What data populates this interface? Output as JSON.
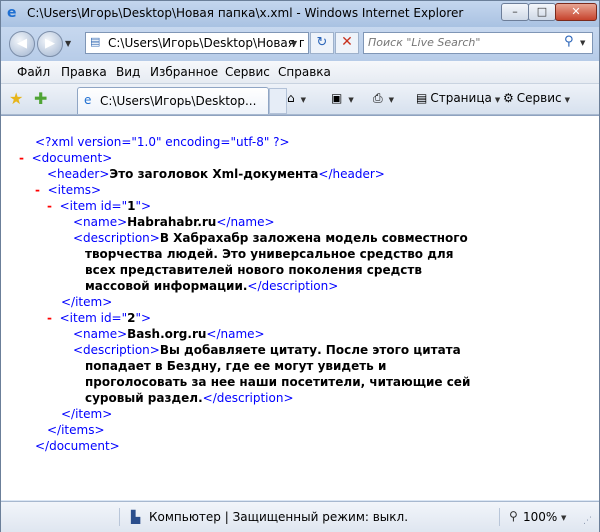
{
  "window": {
    "title": "C:\\Users\\Игорь\\Desktop\\Новая папка\\x.xml - Windows Internet Explorer",
    "minimize": "–",
    "maximize": "□",
    "close": "✕"
  },
  "address_bar": {
    "url": "C:\\Users\\Игорь\\Desktop\\Новая па",
    "search_placeholder": "Поиск \"Live Search\""
  },
  "menu": [
    "Файл",
    "Правка",
    "Вид",
    "Избранное",
    "Сервис",
    "Справка"
  ],
  "tab": {
    "title": "C:\\Users\\Игорь\\Desktop..."
  },
  "toolbar": {
    "page_label": "Страница",
    "tools_label": "Сервис"
  },
  "xml": {
    "declaration": "<?xml version=\"1.0\" encoding=\"utf-8\" ?>",
    "toggle": "-",
    "document_open": "<document>",
    "header_open": "<header>",
    "header_text": "Это заголовок Xml-документа",
    "header_close": "</header>",
    "items_open": "<items>",
    "item1_tag": "<item id=\"",
    "item1_id": "1",
    "item1_tagend": "\">",
    "name_open": "<name>",
    "name_close": "</name>",
    "item1_name": "Habrahabr.ru",
    "desc_open": "<description>",
    "desc_close": "</description>",
    "item1_desc": [
      "В Хабрахабр заложена модель совместного",
      "творчества людей. Это универсальное средство для",
      "всех представителей нового поколения средств",
      "массовой информации."
    ],
    "item_close": "</item>",
    "item2_id": "2",
    "item2_name": "Bash.org.ru",
    "item2_desc": [
      "Вы добавляете цитату. После этого цитата",
      "попадает в Бездну, где ее могут увидеть и",
      "проголосовать за нее наши посетители, читающие сей",
      "суровый раздел."
    ],
    "items_close": "</items>",
    "document_close": "</document>"
  },
  "status": {
    "zone_text": "Компьютер | Защищенный режим: выкл.",
    "zoom": "100%"
  }
}
